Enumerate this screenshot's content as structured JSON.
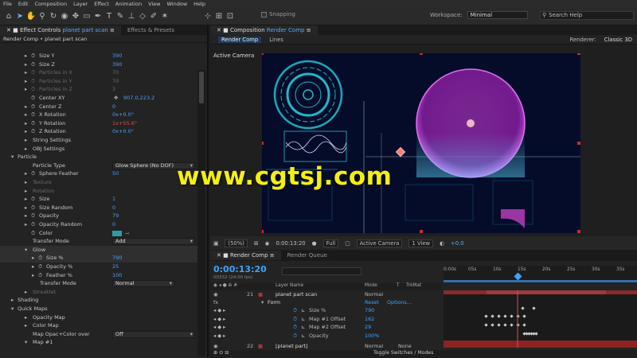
{
  "menu": [
    "File",
    "Edit",
    "Composition",
    "Layer",
    "Effect",
    "Animation",
    "View",
    "Window",
    "Help"
  ],
  "toolbar": {
    "snapping": "Snapping",
    "workspace_label": "Workspace:",
    "workspace_value": "Minimal",
    "search_placeholder": "Search Help"
  },
  "effect_panel": {
    "tab_label": "Effect Controls",
    "tab_layer": "planet part scan",
    "tab2": "Effects & Presets",
    "subtitle": "Render Comp • planet part scan",
    "rows": [
      {
        "name": "Size Y",
        "value": "390",
        "indent": 2,
        "dim": false,
        "arrow": "▸",
        "stopwatch": true
      },
      {
        "name": "Size Z",
        "value": "390",
        "indent": 2,
        "dim": false,
        "arrow": "▸",
        "stopwatch": true
      },
      {
        "name": "Particles in X",
        "value": "70",
        "indent": 2,
        "dim": true,
        "arrow": "▸",
        "stopwatch": true
      },
      {
        "name": "Particles in Y",
        "value": "70",
        "indent": 2,
        "dim": true,
        "arrow": "▸",
        "stopwatch": true
      },
      {
        "name": "Particles in Z",
        "value": "3",
        "indent": 2,
        "dim": true,
        "arrow": "▸",
        "stopwatch": true
      },
      {
        "name": "Center XY",
        "value": "907.0,223.2",
        "indent": 2,
        "dim": false,
        "arrow": "",
        "stopwatch": true
      },
      {
        "name": "Center Z",
        "value": "0",
        "indent": 2,
        "dim": false,
        "arrow": "▸",
        "stopwatch": true
      },
      {
        "name": "X Rotation",
        "value": "0x+0.0°",
        "indent": 2,
        "dim": false,
        "arrow": "▸",
        "stopwatch": true
      },
      {
        "name": "Y Rotation",
        "value": "1x+55.6°",
        "indent": 2,
        "dim": false,
        "arrow": "▸",
        "stopwatch": true,
        "red": true
      },
      {
        "name": "Z Rotation",
        "value": "0x+0.0°",
        "indent": 2,
        "dim": false,
        "arrow": "▸",
        "stopwatch": true
      },
      {
        "name": "String Settings",
        "value": "",
        "indent": 2,
        "dim": false,
        "arrow": "▸",
        "stopwatch": false
      },
      {
        "name": "OBJ Settings",
        "value": "",
        "indent": 2,
        "dim": false,
        "arrow": "▸",
        "stopwatch": false
      },
      {
        "name": "Particle",
        "value": "",
        "indent": 1,
        "dim": false,
        "arrow": "▾",
        "stopwatch": false
      },
      {
        "name": "Particle Type",
        "value": "",
        "indent": 2,
        "dim": false,
        "arrow": "",
        "stopwatch": false,
        "select": "Glow Sphere (No DOF)"
      },
      {
        "name": "Sphere Feather",
        "value": "50",
        "indent": 2,
        "dim": false,
        "arrow": "▸",
        "stopwatch": true
      },
      {
        "name": "Texture",
        "value": "",
        "indent": 2,
        "dim": true,
        "arrow": "▸",
        "stopwatch": false
      },
      {
        "name": "Rotation",
        "value": "",
        "indent": 2,
        "dim": true,
        "arrow": "▸",
        "stopwatch": false
      },
      {
        "name": "Size",
        "value": "1",
        "indent": 2,
        "dim": false,
        "arrow": "▸",
        "stopwatch": true
      },
      {
        "name": "Size Random",
        "value": "0",
        "indent": 2,
        "dim": false,
        "arrow": "▸",
        "stopwatch": true
      },
      {
        "name": "Opacity",
        "value": "79",
        "indent": 2,
        "dim": false,
        "arrow": "▸",
        "stopwatch": true
      },
      {
        "name": "Opacity Random",
        "value": "0",
        "indent": 2,
        "dim": false,
        "arrow": "▸",
        "stopwatch": true
      },
      {
        "name": "Color",
        "value": "",
        "indent": 2,
        "dim": false,
        "arrow": "",
        "stopwatch": true,
        "swatch": "#2a9ea8"
      },
      {
        "name": "Transfer Mode",
        "value": "",
        "indent": 2,
        "dim": false,
        "arrow": "",
        "stopwatch": false,
        "select": "Add"
      },
      {
        "name": "Glow",
        "value": "",
        "indent": 2,
        "dim": false,
        "arrow": "▾",
        "stopwatch": false,
        "hl": true
      },
      {
        "name": "Size %",
        "value": "790",
        "indent": 3,
        "dim": false,
        "arrow": "▸",
        "stopwatch": true,
        "hl": true
      },
      {
        "name": "Opacity %",
        "value": "25",
        "indent": 3,
        "dim": false,
        "arrow": "▸",
        "stopwatch": true
      },
      {
        "name": "Feather %",
        "value": "100",
        "indent": 3,
        "dim": false,
        "arrow": "▸",
        "stopwatch": true
      },
      {
        "name": "Transfer Mode",
        "value": "",
        "indent": 3,
        "dim": false,
        "arrow": "",
        "stopwatch": false,
        "select": "Normal"
      },
      {
        "name": "Streaklet",
        "value": "",
        "indent": 2,
        "dim": true,
        "arrow": "▸",
        "stopwatch": false
      },
      {
        "name": "Shading",
        "value": "",
        "indent": 1,
        "dim": false,
        "arrow": "▸",
        "stopwatch": false
      },
      {
        "name": "Quick Maps",
        "value": "",
        "indent": 1,
        "dim": false,
        "arrow": "▾",
        "stopwatch": false
      },
      {
        "name": "Opacity Map",
        "value": "",
        "indent": 2,
        "dim": false,
        "arrow": "▸",
        "stopwatch": false
      },
      {
        "name": "Color Map",
        "value": "",
        "indent": 2,
        "dim": false,
        "arrow": "▸",
        "stopwatch": false
      },
      {
        "name": "Map Opac+Color over",
        "value": "",
        "indent": 2,
        "dim": false,
        "arrow": "",
        "stopwatch": false,
        "select": "Off"
      },
      {
        "name": "Map #1",
        "value": "",
        "indent": 2,
        "dim": false,
        "arrow": "▾",
        "stopwatch": false
      }
    ]
  },
  "comp_panel": {
    "tab_label": "Composition",
    "tab_comp": "Render Comp",
    "flow": [
      "Render Comp",
      "Lines"
    ],
    "renderer_label": "Renderer:",
    "renderer_value": "Classic 3D",
    "active_camera": "Active Camera",
    "bottom": {
      "zoom": "(50%)",
      "timecode": "0:00:13:20",
      "resolution": "Full",
      "camera": "Active Camera",
      "views": "1 View",
      "exposure": "+0.0"
    }
  },
  "timeline": {
    "tab": "Render Comp",
    "tab2": "Render Queue",
    "timecode": "0:00:13:20",
    "fps": "00332 (24.00 fps)",
    "ruler": [
      "0:00s",
      "05s",
      "10s",
      "15s",
      "20s",
      "25s",
      "30s",
      "35s"
    ],
    "cols": {
      "layer_name": "Layer Name",
      "mode": "Mode",
      "t": "T",
      "trkmat": "TrkMat"
    },
    "layers": [
      {
        "num": "21",
        "name": "planet part scan",
        "mode": "Normal",
        "trkmat": ""
      },
      {
        "num": "22",
        "name": "[planet part]",
        "mode": "Normal",
        "trkmat": "None"
      }
    ],
    "form": {
      "name": "Form",
      "reset": "Reset",
      "options": "Options..."
    },
    "props": [
      {
        "name": "Size %",
        "value": "790"
      },
      {
        "name": "Map #1 Offset",
        "value": "162"
      },
      {
        "name": "Map #2 Offset",
        "value": "29"
      },
      {
        "name": "Opacity",
        "value": "100%"
      }
    ],
    "footer": "Toggle Switches / Modes"
  },
  "watermark": "www.cgtsj.com",
  "colors": {
    "accent": "#3da5ff",
    "viewer_bg": "#050c2a",
    "planet": "#c02fd0",
    "hud": "#1fb8c8",
    "keyframe_red": "#e04848"
  }
}
